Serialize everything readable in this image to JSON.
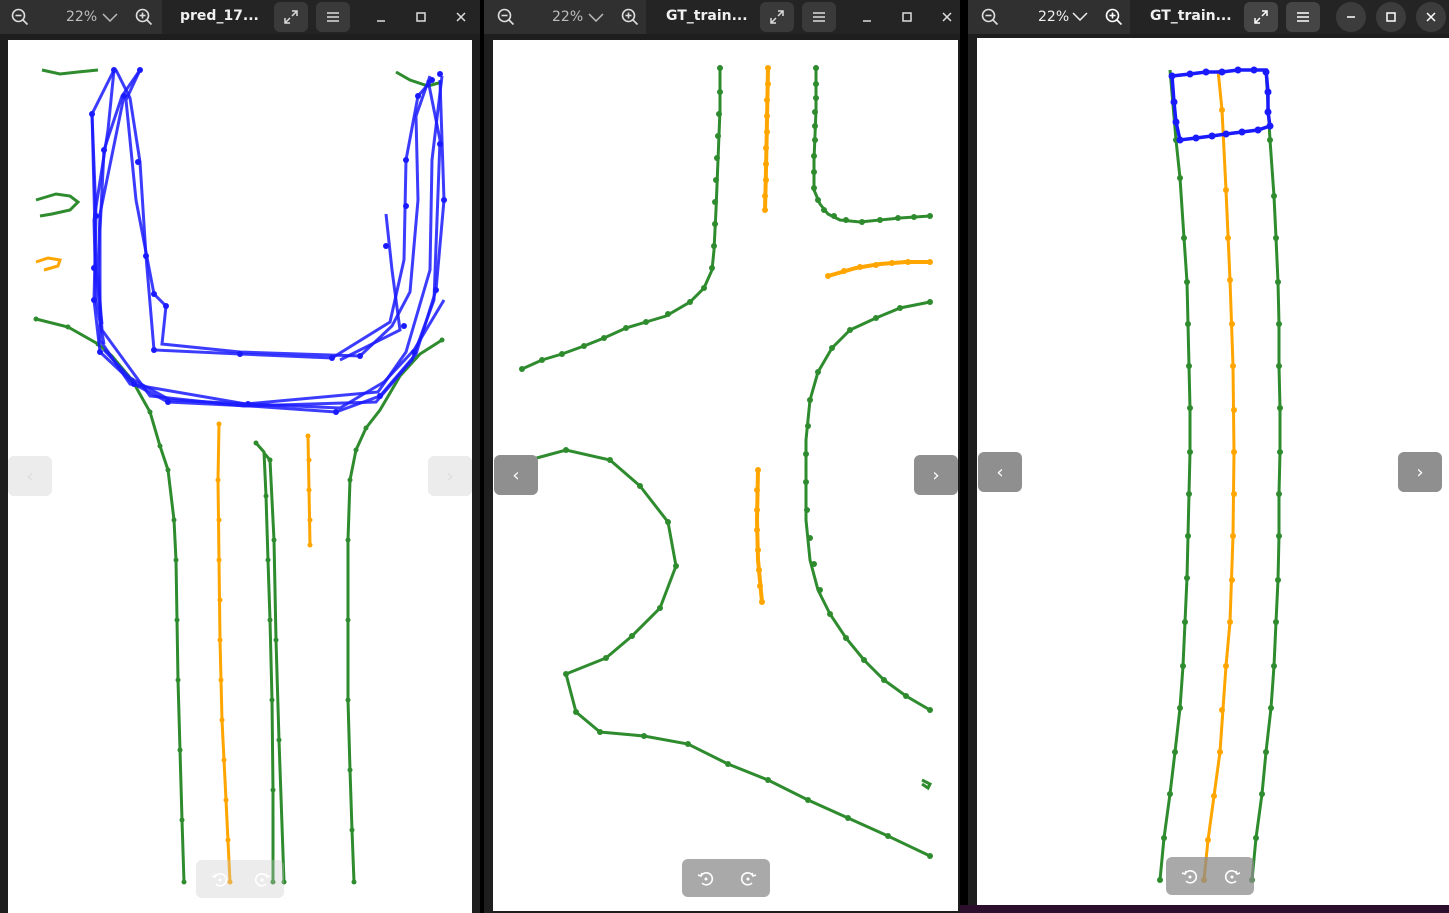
{
  "windows": [
    {
      "zoom": "22%",
      "title": "pred_17...",
      "nav_prev": "‹",
      "nav_next": "›"
    },
    {
      "zoom": "22%",
      "title": "GT_train...",
      "nav_prev": "‹",
      "nav_next": "›"
    },
    {
      "zoom": "22%",
      "title": "GT_train...",
      "nav_prev": "‹",
      "nav_next": "›"
    }
  ],
  "icons": {
    "zoom_out": "zoom-out-icon",
    "zoom_in": "zoom-in-icon",
    "fullscreen": "fullscreen-icon",
    "menu": "menu-icon",
    "minimize": "minimize-icon",
    "maximize": "maximize-icon",
    "close": "close-icon",
    "rotate_left": "rotate-left-icon",
    "rotate_right": "rotate-right-icon"
  },
  "colors": {
    "boundary": "#2e8b2e",
    "centerline": "#ffa500",
    "crossing": "#1a1aff",
    "titlebar": "#242424",
    "canvas": "#ffffff"
  }
}
